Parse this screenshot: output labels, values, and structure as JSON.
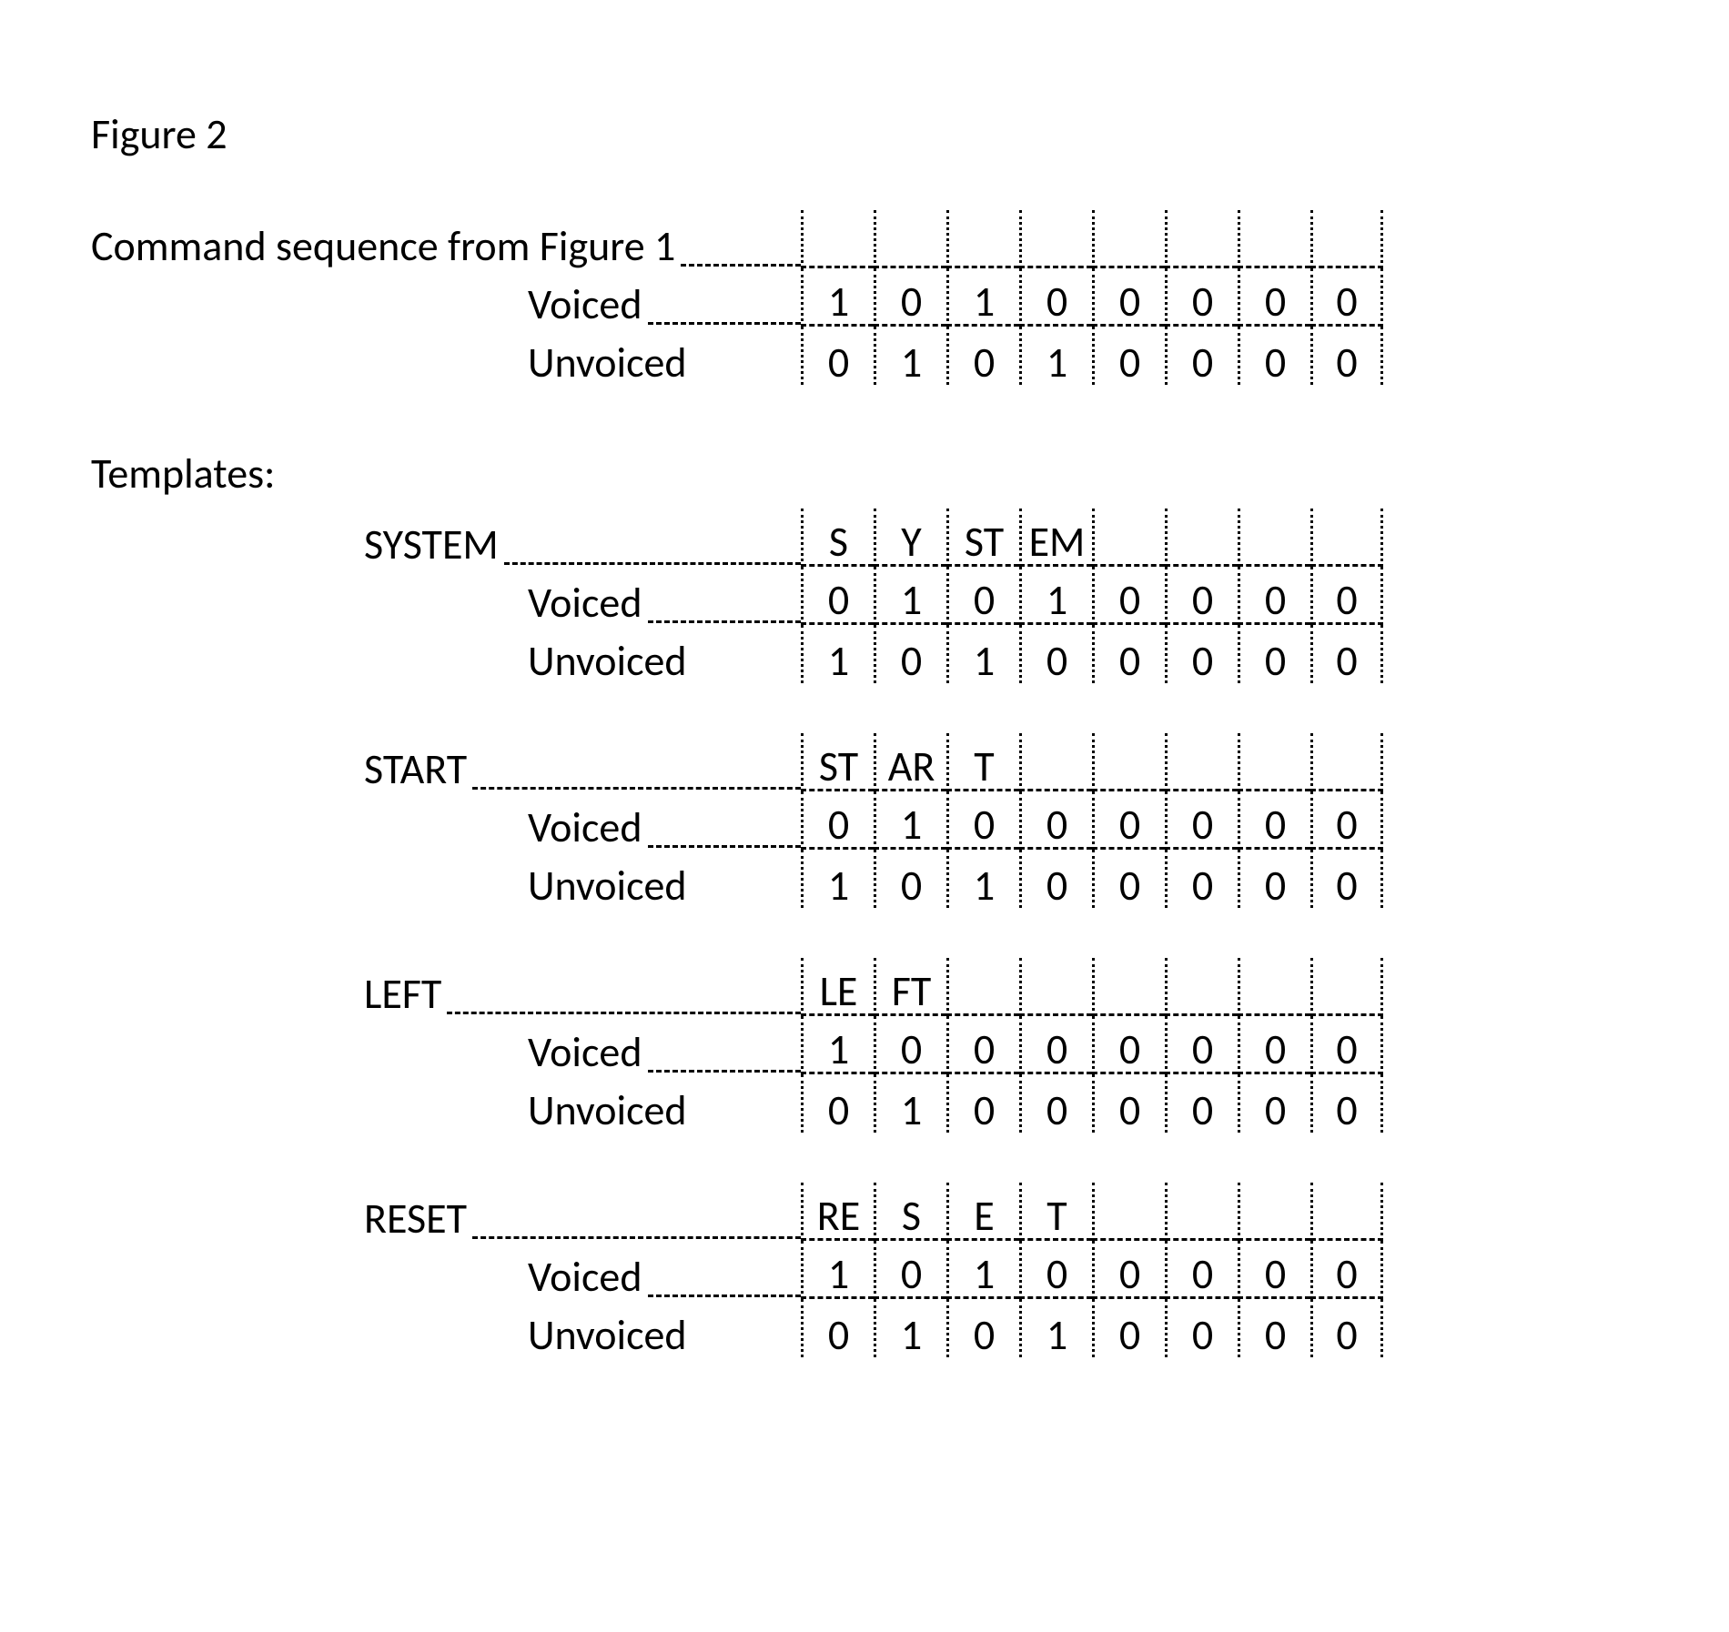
{
  "figure_label": "Figure 2",
  "top_caption": "Command sequence from Figure 1",
  "labels": {
    "voiced": "Voiced",
    "unvoiced": "Unvoiced",
    "templates": "Templates:"
  },
  "command_sequence": {
    "voiced": [
      "1",
      "0",
      "1",
      "0",
      "0",
      "0",
      "0",
      "0"
    ],
    "unvoiced": [
      "0",
      "1",
      "0",
      "1",
      "0",
      "0",
      "0",
      "0"
    ]
  },
  "templates": [
    {
      "name": "SYSTEM",
      "header": [
        "S",
        "Y",
        "ST",
        "EM",
        "",
        "",
        "",
        ""
      ],
      "voiced": [
        "0",
        "1",
        "0",
        "1",
        "0",
        "0",
        "0",
        "0"
      ],
      "unvoiced": [
        "1",
        "0",
        "1",
        "0",
        "0",
        "0",
        "0",
        "0"
      ]
    },
    {
      "name": "START",
      "header": [
        "ST",
        "AR",
        "T",
        "",
        "",
        "",
        "",
        ""
      ],
      "voiced": [
        "0",
        "1",
        "0",
        "0",
        "0",
        "0",
        "0",
        "0"
      ],
      "unvoiced": [
        "1",
        "0",
        "1",
        "0",
        "0",
        "0",
        "0",
        "0"
      ]
    },
    {
      "name": "LEFT",
      "header": [
        "LE",
        "FT",
        "",
        "",
        "",
        "",
        "",
        ""
      ],
      "voiced": [
        "1",
        "0",
        "0",
        "0",
        "0",
        "0",
        "0",
        "0"
      ],
      "unvoiced": [
        "0",
        "1",
        "0",
        "0",
        "0",
        "0",
        "0",
        "0"
      ]
    },
    {
      "name": "RESET",
      "header": [
        "RE",
        "S",
        "E",
        "T",
        "",
        "",
        "",
        ""
      ],
      "voiced": [
        "1",
        "0",
        "1",
        "0",
        "0",
        "0",
        "0",
        "0"
      ],
      "unvoiced": [
        "0",
        "1",
        "0",
        "1",
        "0",
        "0",
        "0",
        "0"
      ]
    }
  ],
  "chart_data": {
    "type": "table",
    "title": "Figure 2",
    "subtitle": "Command sequence from Figure 1",
    "columns": [
      "col1",
      "col2",
      "col3",
      "col4",
      "col5",
      "col6",
      "col7",
      "col8"
    ],
    "sections": [
      {
        "name": "Command sequence from Figure 1",
        "rows": [
          {
            "label": "Voiced",
            "values": [
              1,
              0,
              1,
              0,
              0,
              0,
              0,
              0
            ]
          },
          {
            "label": "Unvoiced",
            "values": [
              0,
              1,
              0,
              1,
              0,
              0,
              0,
              0
            ]
          }
        ]
      },
      {
        "name": "SYSTEM",
        "header": [
          "S",
          "Y",
          "ST",
          "EM",
          "",
          "",
          "",
          ""
        ],
        "rows": [
          {
            "label": "Voiced",
            "values": [
              0,
              1,
              0,
              1,
              0,
              0,
              0,
              0
            ]
          },
          {
            "label": "Unvoiced",
            "values": [
              1,
              0,
              1,
              0,
              0,
              0,
              0,
              0
            ]
          }
        ]
      },
      {
        "name": "START",
        "header": [
          "ST",
          "AR",
          "T",
          "",
          "",
          "",
          "",
          ""
        ],
        "rows": [
          {
            "label": "Voiced",
            "values": [
              0,
              1,
              0,
              0,
              0,
              0,
              0,
              0
            ]
          },
          {
            "label": "Unvoiced",
            "values": [
              1,
              0,
              1,
              0,
              0,
              0,
              0,
              0
            ]
          }
        ]
      },
      {
        "name": "LEFT",
        "header": [
          "LE",
          "FT",
          "",
          "",
          "",
          "",
          "",
          ""
        ],
        "rows": [
          {
            "label": "Voiced",
            "values": [
              1,
              0,
              0,
              0,
              0,
              0,
              0,
              0
            ]
          },
          {
            "label": "Unvoiced",
            "values": [
              0,
              1,
              0,
              0,
              0,
              0,
              0,
              0
            ]
          }
        ]
      },
      {
        "name": "RESET",
        "header": [
          "RE",
          "S",
          "E",
          "T",
          "",
          "",
          "",
          ""
        ],
        "rows": [
          {
            "label": "Voiced",
            "values": [
              1,
              0,
              1,
              0,
              0,
              0,
              0,
              0
            ]
          },
          {
            "label": "Unvoiced",
            "values": [
              0,
              1,
              0,
              1,
              0,
              0,
              0,
              0
            ]
          }
        ]
      }
    ]
  }
}
